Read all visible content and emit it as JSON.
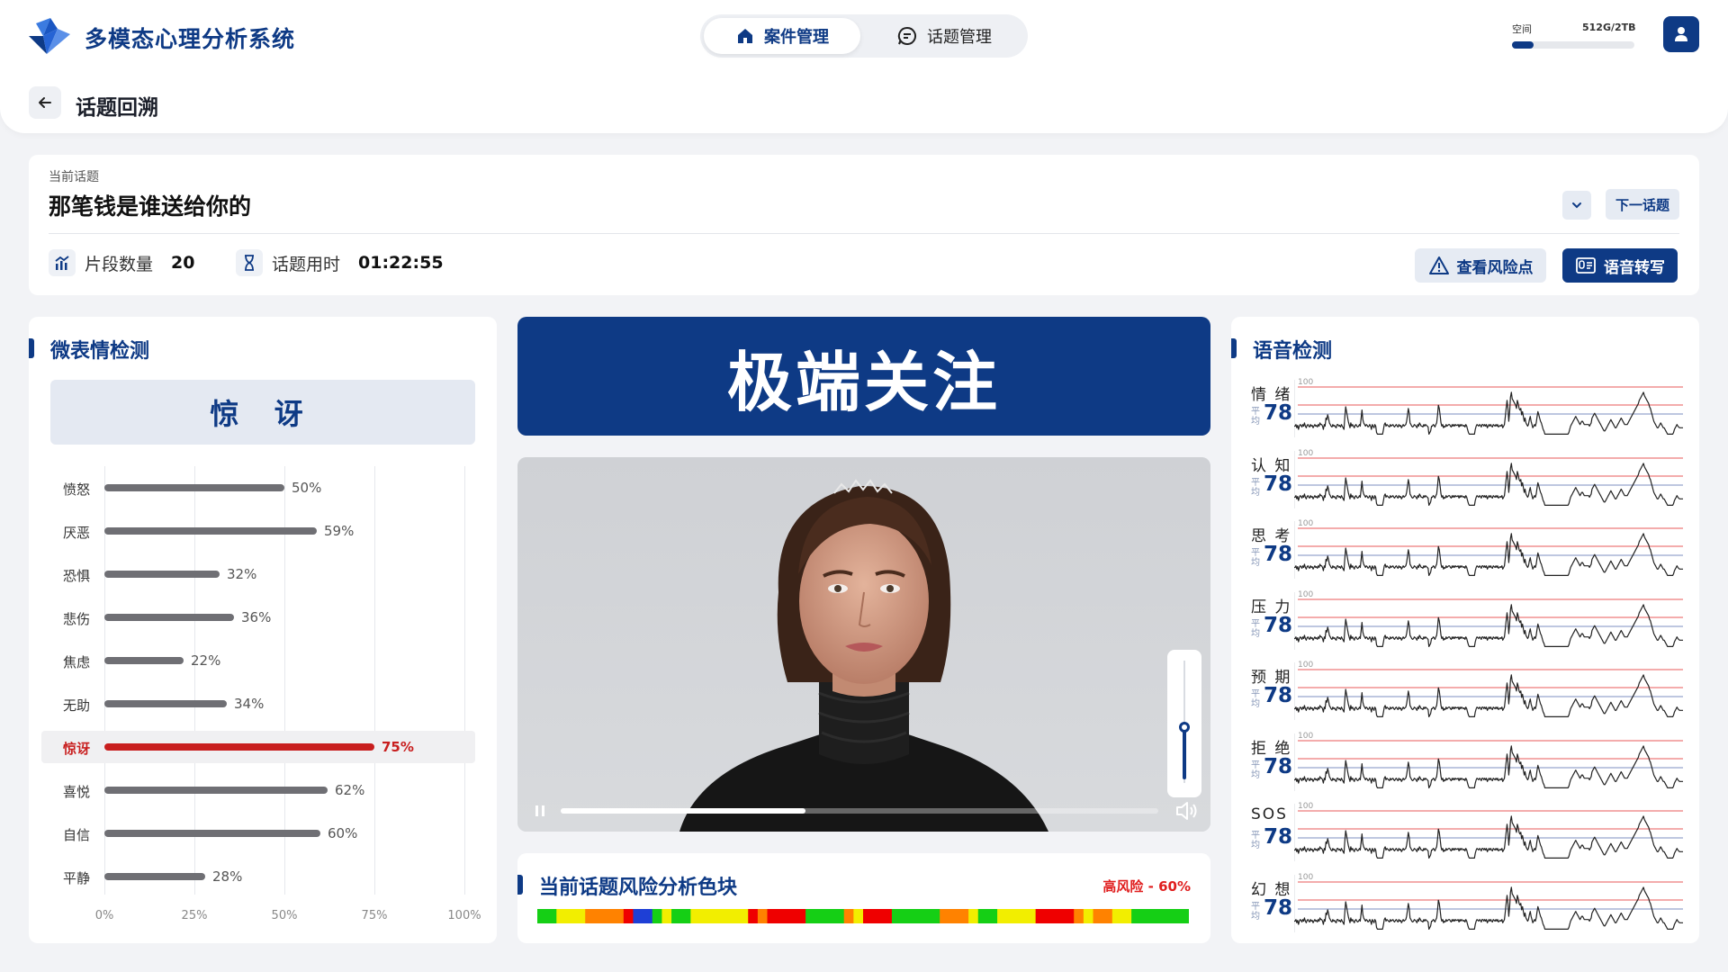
{
  "header": {
    "app_title": "多模态心理分析系统",
    "nav": [
      {
        "label": "案件管理",
        "icon": "home-icon",
        "active": true
      },
      {
        "label": "话题管理",
        "icon": "chat-icon",
        "active": false
      }
    ],
    "storage": {
      "label": "空间",
      "value": "512G/2TB",
      "fraction": 0.18
    },
    "page_title": "话题回溯"
  },
  "topic": {
    "label": "当前话题",
    "name": "那笔钱是谁送给你的",
    "next_label": "下一话题",
    "segments_label": "片段数量",
    "segments_value": "20",
    "duration_label": "话题用时",
    "duration_value": "01:22:55",
    "risk_btn": "查看风险点",
    "asr_btn": "语音转写"
  },
  "micro": {
    "title": "微表情检测",
    "current": "惊 讶",
    "items": [
      {
        "label": "愤怒",
        "value": 50,
        "text": "50%"
      },
      {
        "label": "厌恶",
        "value": 59,
        "text": "59%"
      },
      {
        "label": "恐惧",
        "value": 32,
        "text": "32%"
      },
      {
        "label": "悲伤",
        "value": 36,
        "text": "36%"
      },
      {
        "label": "焦虑",
        "value": 22,
        "text": "22%"
      },
      {
        "label": "无助",
        "value": 34,
        "text": "34%"
      },
      {
        "label": "惊讶",
        "value": 75,
        "text": "75%",
        "highlight": true
      },
      {
        "label": "喜悦",
        "value": 62,
        "text": "62%"
      },
      {
        "label": "自信",
        "value": 60,
        "text": "60%"
      },
      {
        "label": "平静",
        "value": 28,
        "text": "28%"
      }
    ],
    "axis": [
      "0%",
      "25%",
      "50%",
      "75%",
      "100%"
    ]
  },
  "center": {
    "banner": "极端关注",
    "video_progress": 0.41,
    "volume": 0.42
  },
  "risk": {
    "title": "当前话题风险分析色块",
    "level": "高风险 - 60%",
    "blocks": [
      [
        "#15cf15",
        2
      ],
      [
        "#f2ee00",
        3
      ],
      [
        "#ff8200",
        4
      ],
      [
        "#ef0000",
        1
      ],
      [
        "#1e3fd6",
        2
      ],
      [
        "#15cf15",
        1
      ],
      [
        "#f2ee00",
        1
      ],
      [
        "#15cf15",
        2
      ],
      [
        "#f2ee00",
        6
      ],
      [
        "#ef0000",
        1
      ],
      [
        "#ff8200",
        1
      ],
      [
        "#ef0000",
        4
      ],
      [
        "#15cf15",
        4
      ],
      [
        "#ff8200",
        1
      ],
      [
        "#f2ee00",
        1
      ],
      [
        "#ef0000",
        3
      ],
      [
        "#15cf15",
        5
      ],
      [
        "#ff8200",
        3
      ],
      [
        "#f2ee00",
        1
      ],
      [
        "#15cf15",
        2
      ],
      [
        "#f2ee00",
        4
      ],
      [
        "#ef0000",
        4
      ],
      [
        "#ff8200",
        1
      ],
      [
        "#f2ee00",
        1
      ],
      [
        "#ff8200",
        2
      ],
      [
        "#f2ee00",
        2
      ],
      [
        "#15cf15",
        6
      ]
    ]
  },
  "speech": {
    "title": "语音检测",
    "avg_label": "平均",
    "max_label": "100",
    "rows": [
      {
        "label": "情 绪",
        "score": "78"
      },
      {
        "label": "认 知",
        "score": "78"
      },
      {
        "label": "思 考",
        "score": "78"
      },
      {
        "label": "压 力",
        "score": "78"
      },
      {
        "label": "预 期",
        "score": "78"
      },
      {
        "label": "拒 绝",
        "score": "78"
      },
      {
        "label": "SOS",
        "score": "78"
      },
      {
        "label": "幻 想",
        "score": "78"
      }
    ],
    "wave": [
      62,
      62,
      60,
      64,
      61,
      66,
      62,
      60,
      61,
      63,
      60,
      62,
      58,
      62,
      64,
      61,
      60,
      62,
      63,
      60,
      62,
      61,
      64,
      62,
      60,
      62,
      61,
      63,
      60,
      62,
      58,
      60,
      60,
      62,
      66,
      60,
      62,
      52,
      54,
      48,
      52,
      58,
      60,
      62,
      63,
      60,
      62,
      61,
      63,
      64,
      60,
      60,
      62,
      61,
      63,
      60,
      62,
      64,
      66,
      50,
      38,
      44,
      50,
      56,
      60,
      64,
      58,
      62,
      60,
      62,
      64,
      61,
      60,
      62,
      63,
      62,
      60,
      62,
      52,
      42,
      54,
      58,
      60,
      62,
      60,
      61,
      63,
      62,
      60,
      62,
      66,
      60,
      62,
      64,
      60,
      62,
      70,
      72,
      72,
      72,
      72,
      72,
      72,
      72,
      66,
      60,
      58,
      62,
      60,
      61,
      62,
      63,
      60,
      62,
      61,
      60,
      62,
      63,
      61,
      60,
      62,
      63,
      60,
      62,
      61,
      64,
      62,
      60,
      62,
      61,
      60,
      56,
      48,
      40,
      46,
      58,
      60,
      62,
      63,
      62,
      60,
      61,
      62,
      64,
      60,
      62,
      58,
      60,
      62,
      62,
      63,
      60,
      62,
      60,
      61,
      62,
      63,
      72,
      70,
      68,
      62,
      62,
      60,
      61,
      63,
      60,
      58,
      48,
      36,
      40,
      48,
      58,
      62,
      60,
      64,
      62,
      63,
      60,
      62,
      61,
      60,
      60,
      62,
      63,
      60,
      62,
      60,
      62,
      60,
      61,
      61,
      60,
      63,
      60,
      62,
      60,
      61,
      62,
      61,
      63,
      60,
      62,
      66,
      70,
      72,
      72,
      72,
      72,
      72,
      72,
      72,
      66,
      62,
      60,
      61,
      62,
      60,
      61,
      63,
      60,
      60,
      62,
      60,
      62,
      60,
      64,
      62,
      60,
      62,
      60,
      62,
      63,
      60,
      61,
      62,
      60,
      62,
      60,
      63,
      62,
      61,
      62,
      60,
      64,
      62,
      60,
      50,
      40,
      30,
      40,
      56,
      44,
      26,
      20,
      28,
      30,
      32,
      34,
      36,
      40,
      30,
      34,
      40,
      42,
      40,
      48,
      44,
      50,
      56,
      52,
      58,
      60,
      62,
      60,
      54,
      50,
      56,
      60,
      64,
      62,
      60,
      62,
      58,
      50,
      44,
      48,
      52,
      56,
      58,
      62,
      66,
      68,
      72,
      72,
      72,
      72,
      72,
      72,
      72,
      72,
      72,
      72,
      72,
      72,
      72,
      72,
      72,
      72,
      72,
      72,
      72,
      72,
      72,
      72,
      72,
      72,
      72,
      72,
      72,
      72,
      70,
      66,
      62,
      60,
      58,
      56,
      54,
      52,
      50,
      52,
      54,
      56,
      58,
      60,
      58,
      56,
      56,
      58,
      60,
      60,
      60,
      60,
      60,
      60,
      62,
      60,
      58,
      52,
      50,
      48,
      46,
      48,
      50,
      52,
      54,
      56,
      58,
      60,
      62,
      64,
      66,
      68,
      68,
      66,
      64,
      62,
      60,
      58,
      56,
      54,
      56,
      58,
      60,
      62,
      64,
      64,
      62,
      60,
      58,
      56,
      54,
      52,
      54,
      56,
      58,
      60,
      60,
      60,
      60,
      58,
      56,
      54,
      52,
      50,
      48,
      46,
      44,
      42,
      40,
      38,
      36,
      34,
      30,
      28,
      26,
      24,
      22,
      20,
      24,
      26,
      28,
      30,
      32,
      34,
      38,
      40,
      44,
      48,
      52,
      56,
      58,
      60,
      62,
      64,
      64,
      62,
      60,
      58,
      60,
      62,
      64,
      64,
      66,
      68,
      70,
      72,
      72,
      72,
      72,
      72,
      72,
      72,
      70,
      66,
      64,
      62,
      60,
      62,
      63,
      64,
      64,
      64,
      64,
      64
    ]
  }
}
